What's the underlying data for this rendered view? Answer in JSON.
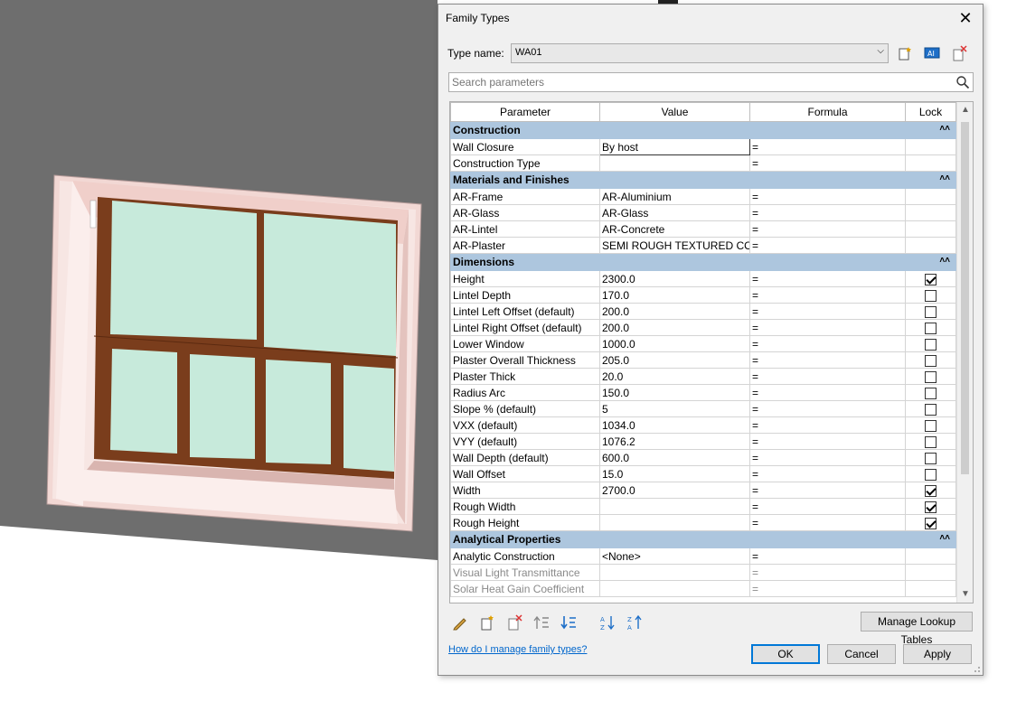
{
  "dialog": {
    "title": "Family Types",
    "type_name_label": "Type name:",
    "type_name_value": "WA01",
    "search_placeholder": "Search parameters",
    "columns": [
      "Parameter",
      "Value",
      "Formula",
      "Lock"
    ],
    "groups": [
      {
        "name": "Construction",
        "rows": [
          {
            "param": "Wall Closure",
            "value": "By host",
            "formula": "=",
            "lock": null,
            "editing": true
          },
          {
            "param": "Construction Type",
            "value": "",
            "formula": "=",
            "lock": null
          }
        ]
      },
      {
        "name": "Materials and Finishes",
        "rows": [
          {
            "param": "AR-Frame",
            "value": "AR-Aluminium",
            "formula": "=",
            "lock": null
          },
          {
            "param": "AR-Glass",
            "value": "AR-Glass",
            "formula": "=",
            "lock": null
          },
          {
            "param": "AR-Lintel",
            "value": "AR-Concrete",
            "formula": "=",
            "lock": null
          },
          {
            "param": "AR-Plaster",
            "value": "SEMI ROUGH TEXTURED CO",
            "formula": "=",
            "lock": null
          }
        ]
      },
      {
        "name": "Dimensions",
        "rows": [
          {
            "param": "Height",
            "value": "2300.0",
            "formula": "=",
            "lock": true
          },
          {
            "param": "Lintel Depth",
            "value": "170.0",
            "formula": "=",
            "lock": false
          },
          {
            "param": "Lintel Left Offset (default)",
            "value": "200.0",
            "formula": "=",
            "lock": false
          },
          {
            "param": "Lintel Right Offset (default)",
            "value": "200.0",
            "formula": "=",
            "lock": false
          },
          {
            "param": "Lower Window",
            "value": "1000.0",
            "formula": "=",
            "lock": false
          },
          {
            "param": "Plaster Overall Thickness",
            "value": "205.0",
            "formula": "=",
            "lock": false
          },
          {
            "param": "Plaster Thick",
            "value": "20.0",
            "formula": "=",
            "lock": false
          },
          {
            "param": "Radius Arc",
            "value": "150.0",
            "formula": "=",
            "lock": false
          },
          {
            "param": "Slope % (default)",
            "value": "5",
            "formula": "=",
            "lock": false
          },
          {
            "param": "VXX (default)",
            "value": "1034.0",
            "formula": "=",
            "lock": false
          },
          {
            "param": "VYY (default)",
            "value": "1076.2",
            "formula": "=",
            "lock": false
          },
          {
            "param": "Wall Depth (default)",
            "value": "600.0",
            "formula": "=",
            "lock": false
          },
          {
            "param": "Wall Offset",
            "value": "15.0",
            "formula": "=",
            "lock": false
          },
          {
            "param": "Width",
            "value": "2700.0",
            "formula": "=",
            "lock": true
          },
          {
            "param": "Rough Width",
            "value": "",
            "formula": "=",
            "lock": true
          },
          {
            "param": "Rough Height",
            "value": "",
            "formula": "=",
            "lock": true
          }
        ]
      },
      {
        "name": "Analytical Properties",
        "rows": [
          {
            "param": "Analytic Construction",
            "value": "<None>",
            "formula": "=",
            "lock": null
          },
          {
            "param": "Visual Light Transmittance",
            "value": "",
            "formula": "=",
            "lock": null,
            "dim": true
          },
          {
            "param": "Solar Heat Gain Coefficient",
            "value": "",
            "formula": "=",
            "lock": null,
            "dim": true
          }
        ]
      }
    ],
    "manage_lookup_label": "Manage Lookup Tables",
    "help_link": "How do I manage family types?",
    "ok_label": "OK",
    "cancel_label": "Cancel",
    "apply_label": "Apply"
  },
  "colors": {
    "group_header": "#adc6de",
    "glass": "#c7eadb",
    "frame": "#7a3d1c",
    "plaster": "#f4dcd8",
    "viewport_wall": "#6e6e6e"
  }
}
